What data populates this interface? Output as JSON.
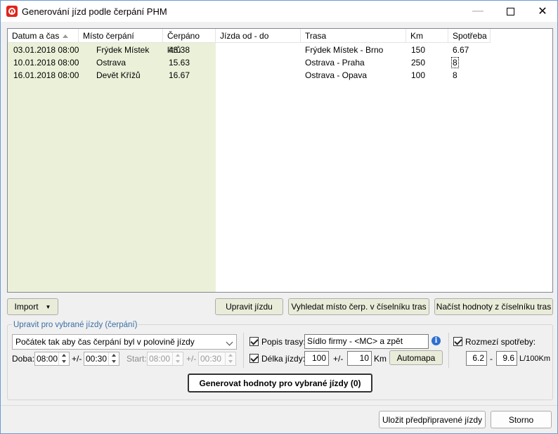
{
  "window": {
    "title": "Generování jízd podle čerpání PHM"
  },
  "grid": {
    "columns": [
      "Datum a čas",
      "Místo čerpání",
      "Čerpáno litrů",
      "Jízda od - do",
      "Trasa",
      "Km",
      "Spotřeba"
    ],
    "rows": [
      {
        "datum": "03.01.2018 08:00",
        "misto": "Frýdek Místek",
        "litru": "43.38",
        "jizda": "",
        "trasa": "Frýdek Místek - Brno",
        "km": "150",
        "spotreba": "6.67"
      },
      {
        "datum": "10.01.2018 08:00",
        "misto": "Ostrava",
        "litru": "15.63",
        "jizda": "",
        "trasa": "Ostrava - Praha",
        "km": "250",
        "spotreba": "8"
      },
      {
        "datum": "16.01.2018 08:00",
        "misto": "Devět Křížů",
        "litru": "16.67",
        "jizda": "",
        "trasa": "Ostrava - Opava",
        "km": "100",
        "spotreba": "8"
      }
    ]
  },
  "toolbar": {
    "import_label": "Import",
    "upravit_label": "Upravit jízdu",
    "vyhledat_label": "Vyhledat místo čerp. v číselníku tras",
    "nacist_label": "Načíst hodnoty z číselníku tras"
  },
  "group": {
    "title": "Upravit pro vybrané jízdy (čerpání)",
    "mode_value": "Počátek tak aby čas čerpání byl v polovině jízdy",
    "doba_label": "Doba:",
    "doba_value": "08:00",
    "tolerance_label": "+/-",
    "doba_tol_value": "00:30",
    "start_label": "Start:",
    "start_value": "08:00",
    "start_tol_value": "00:30",
    "popis_label": "Popis trasy:",
    "popis_value": "Sídlo firmy - <MC> a zpět",
    "delka_label": "Délka jízdy:",
    "delka_value": "100",
    "delka_tol_value": "10",
    "km_unit": "Km",
    "automapa_label": "Automapa",
    "rozmezi_label": "Rozmezí spotřeby:",
    "rozmezi_from": "6.2",
    "rozmezi_dash": "-",
    "rozmezi_to": "9.6",
    "rozmezi_unit": "L/100Km",
    "generate_label": "Generovat hodnoty pro vybrané jízdy (0)"
  },
  "footer": {
    "save_label": "Uložit předpřipravené jízdy",
    "cancel_label": "Storno"
  },
  "colors": {
    "left_pane_bg": "#ebf1d9",
    "group_title": "#3a6ea5"
  }
}
